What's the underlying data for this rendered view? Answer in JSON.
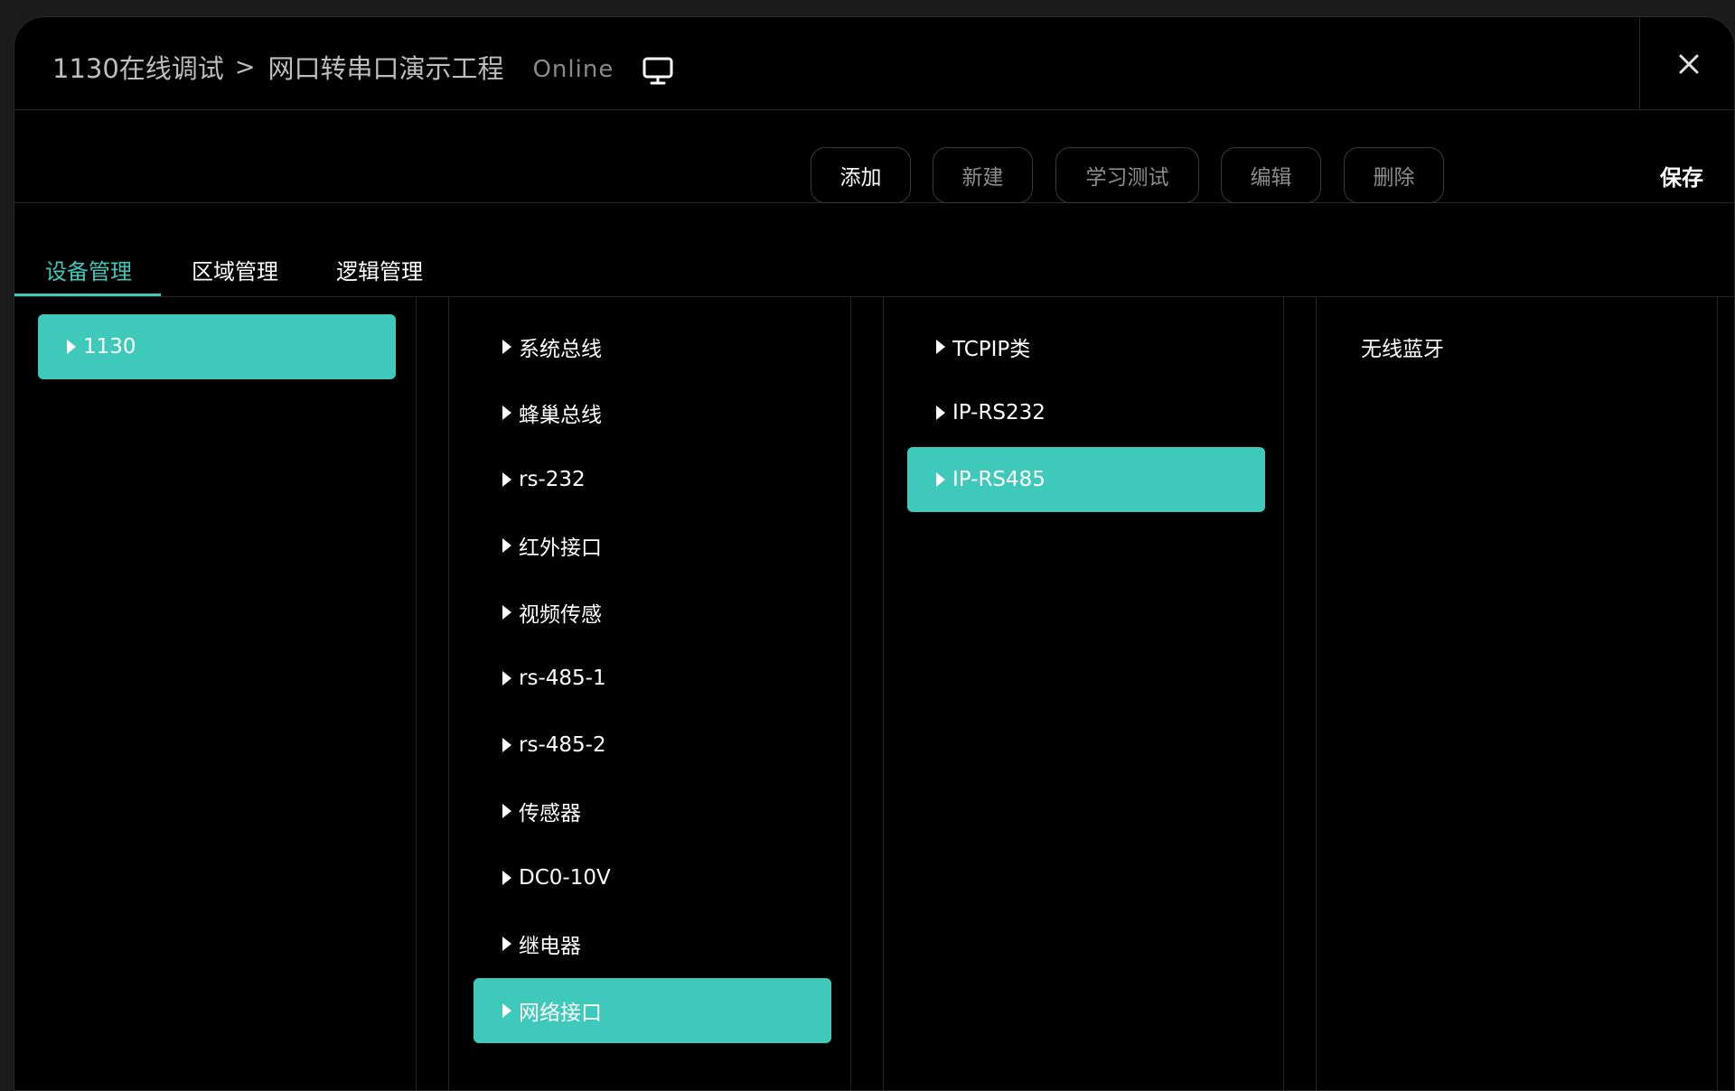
{
  "header": {
    "project": "1130在线调试",
    "separator": ">",
    "page": "网口转串口演示工程",
    "status": "Online",
    "monitor_icon": "monitor-icon",
    "close_icon": "close-icon"
  },
  "toolbar": {
    "buttons": [
      {
        "label": "添加"
      },
      {
        "label": "新建"
      },
      {
        "label": "学习测试"
      },
      {
        "label": "编辑"
      },
      {
        "label": "删除"
      }
    ],
    "save_label": "保存"
  },
  "tabs": [
    {
      "label": "设备管理",
      "active": true
    },
    {
      "label": "区域管理"
    },
    {
      "label": "逻辑管理"
    }
  ],
  "columns": {
    "col1": [
      {
        "label": "1130",
        "selected": true
      }
    ],
    "col2": [
      {
        "label": "系统总线"
      },
      {
        "label": "蜂巢总线"
      },
      {
        "label": "rs-232"
      },
      {
        "label": "红外接口"
      },
      {
        "label": "视频传感"
      },
      {
        "label": "rs-485-1"
      },
      {
        "label": "rs-485-2"
      },
      {
        "label": "传感器"
      },
      {
        "label": "DC0-10V"
      },
      {
        "label": "继电器"
      },
      {
        "label": "网络接口",
        "selected": true
      }
    ],
    "col3": [
      {
        "label": "TCPIP类"
      },
      {
        "label": "IP-RS232"
      },
      {
        "label": "IP-RS485",
        "selected": true
      }
    ],
    "col4": [
      {
        "label": "无线蓝牙"
      }
    ]
  },
  "colors": {
    "accent": "#3ec9bb",
    "background": "#000000",
    "border": "#262626"
  }
}
